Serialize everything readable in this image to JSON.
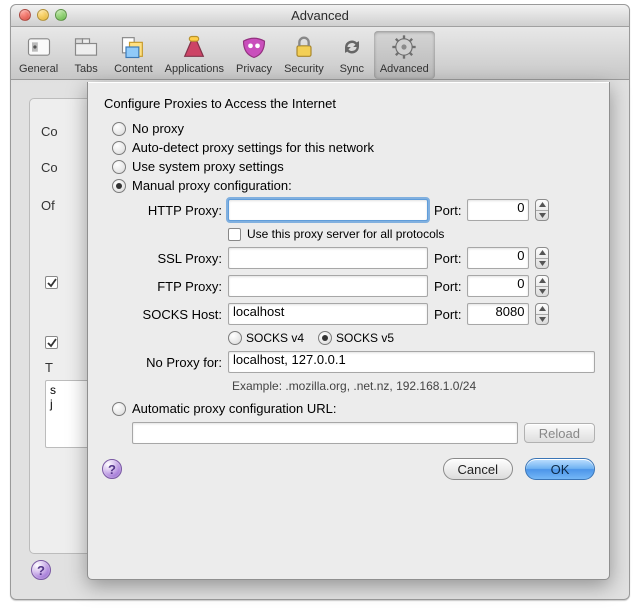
{
  "window": {
    "title": "Advanced"
  },
  "toolbar": {
    "items": [
      {
        "label": "General"
      },
      {
        "label": "Tabs"
      },
      {
        "label": "Content"
      },
      {
        "label": "Applications"
      },
      {
        "label": "Privacy"
      },
      {
        "label": "Security"
      },
      {
        "label": "Sync"
      },
      {
        "label": "Advanced"
      }
    ],
    "selected_index": 7
  },
  "background": {
    "row0": "Co",
    "row1": "Co",
    "row2": "Of",
    "row_t": "T",
    "field_text": "s\nj"
  },
  "sheet": {
    "heading": "Configure Proxies to Access the Internet",
    "mode_options": {
      "none": "No proxy",
      "autodetect": "Auto-detect proxy settings for this network",
      "system": "Use system proxy settings",
      "manual": "Manual proxy configuration:",
      "autoconfig": "Automatic proxy configuration URL:"
    },
    "mode_selected": "manual",
    "labels": {
      "http": "HTTP Proxy:",
      "ssl": "SSL Proxy:",
      "ftp": "FTP Proxy:",
      "socks": "SOCKS Host:",
      "port": "Port:",
      "noproxy": "No Proxy for:",
      "useforall": "Use this proxy server for all protocols",
      "example": "Example: .mozilla.org, .net.nz, 192.168.1.0/24",
      "reload": "Reload",
      "cancel": "Cancel",
      "ok": "OK"
    },
    "values": {
      "http_host": "",
      "http_port": "0",
      "use_for_all": false,
      "ssl_host": "",
      "ssl_port": "0",
      "ftp_host": "",
      "ftp_port": "0",
      "socks_host": "localhost",
      "socks_port": "8080",
      "socks_version": "v5",
      "no_proxy": "localhost, 127.0.0.1",
      "autoconfig_url": ""
    },
    "socks_options": {
      "v4": "SOCKS v4",
      "v5": "SOCKS v5"
    }
  }
}
